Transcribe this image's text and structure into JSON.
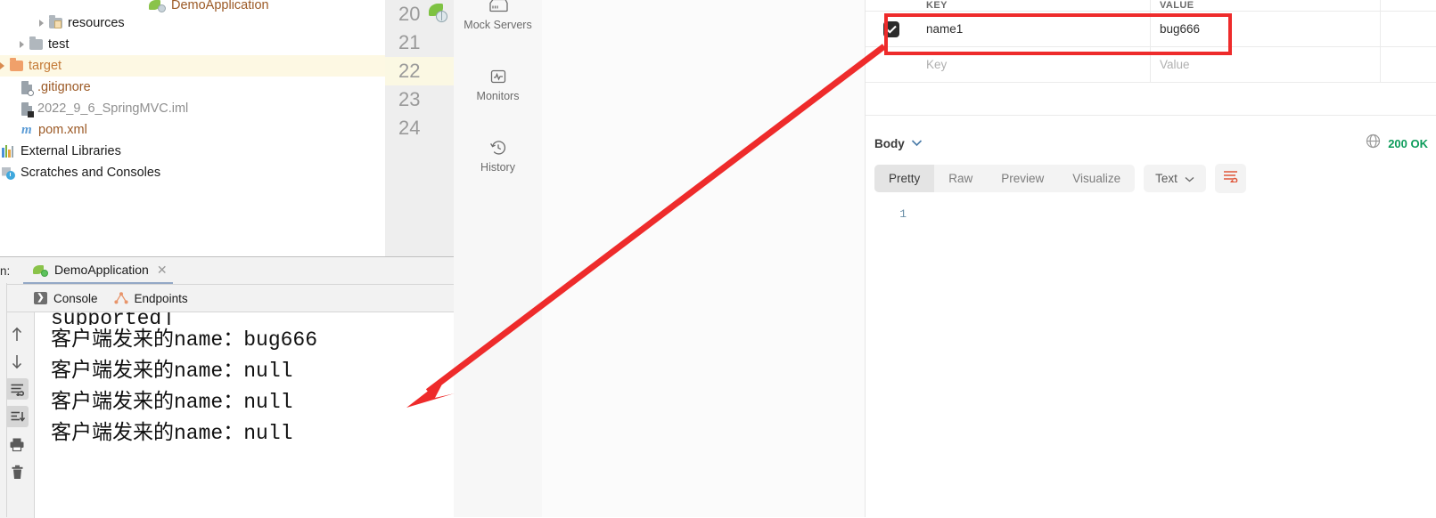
{
  "ide": {
    "project_tree": {
      "items": [
        {
          "label": "DemoApplication",
          "icon": "spring-boot-icon",
          "indent": 166,
          "clipped": true,
          "color": "orange"
        },
        {
          "label": "resources",
          "icon": "folder-resources-icon",
          "indent": 44,
          "arrow": true
        },
        {
          "label": "test",
          "icon": "folder-icon",
          "indent": 22,
          "arrow": true
        },
        {
          "label": "target",
          "icon": "folder-orange-icon",
          "indent": 0,
          "arrow": true,
          "selected": true
        },
        {
          "label": ".gitignore",
          "icon": "file-ignored-icon",
          "indent": 22
        },
        {
          "label": "2022_9_6_SpringMVC.iml",
          "icon": "file-iml-icon",
          "indent": 22
        },
        {
          "label": "pom.xml",
          "icon": "maven-m-icon",
          "indent": 22
        },
        {
          "label": "External Libraries",
          "icon": "libraries-icon",
          "indent": 0
        },
        {
          "label": "Scratches and Consoles",
          "icon": "scratches-icon",
          "indent": 0
        }
      ]
    },
    "editor_gutter": {
      "lines": [
        "20",
        "21",
        "22",
        "23",
        "24"
      ],
      "selected_line": "22",
      "run_marker_icon": "spring-run-gutter-icon"
    },
    "run_panel": {
      "label": "n:",
      "tab_label": "DemoApplication",
      "tab_icon": "spring-boot-icon",
      "close_icon": "close-icon",
      "sub_tabs": [
        {
          "label": "Console",
          "icon": "console-icon",
          "active": true
        },
        {
          "label": "Endpoints",
          "icon": "endpoints-icon",
          "active": false
        }
      ],
      "toolbar": [
        {
          "name": "scroll-up-icon",
          "glyph": "↑",
          "active": false
        },
        {
          "name": "scroll-down-icon",
          "glyph": "↓",
          "active": false
        },
        {
          "name": "soft-wrap-icon",
          "glyph": "wrap",
          "active": true
        },
        {
          "name": "scroll-to-end-icon",
          "glyph": "end",
          "active": true
        },
        {
          "name": "print-icon",
          "glyph": "print",
          "active": false
        },
        {
          "name": "clear-all-icon",
          "glyph": "trash",
          "active": false
        }
      ],
      "console_output": [
        {
          "text": "supported]",
          "clipped": true
        },
        {
          "text": "客户端发来的name：bug666"
        },
        {
          "text": "客户端发来的name：null"
        },
        {
          "text": "客户端发来的name：null"
        },
        {
          "text": "客户端发来的name：null"
        }
      ]
    }
  },
  "postman": {
    "sidebar": [
      {
        "label": "Mock Servers",
        "icon": "mock-server-icon"
      },
      {
        "label": "Monitors",
        "icon": "monitor-pulse-icon"
      },
      {
        "label": "History",
        "icon": "history-clock-icon"
      }
    ],
    "params_table": {
      "headers": [
        "KEY",
        "VALUE"
      ],
      "rows": [
        {
          "checked": true,
          "key": "name1",
          "value": "bug666",
          "highlighted": true
        }
      ],
      "placeholder_row": {
        "key_placeholder": "Key",
        "value_placeholder": "Value"
      }
    },
    "response": {
      "body_label": "Body",
      "body_chevron_icon": "chevron-down-icon",
      "globe_icon": "globe-icon",
      "status": "200 OK",
      "status_color": "#0d9c5b",
      "tabs": [
        {
          "label": "Pretty",
          "active": true
        },
        {
          "label": "Raw",
          "active": false
        },
        {
          "label": "Preview",
          "active": false
        },
        {
          "label": "Visualize",
          "active": false
        }
      ],
      "format_select": {
        "value": "Text",
        "chevron_icon": "chevron-down-icon"
      },
      "wrap_button_icon": "wrap-lines-icon",
      "code_lines": [
        "1"
      ]
    }
  },
  "annotations": {
    "arrow_color": "#ee2b2b",
    "rect_color": "#ee2b2b"
  }
}
